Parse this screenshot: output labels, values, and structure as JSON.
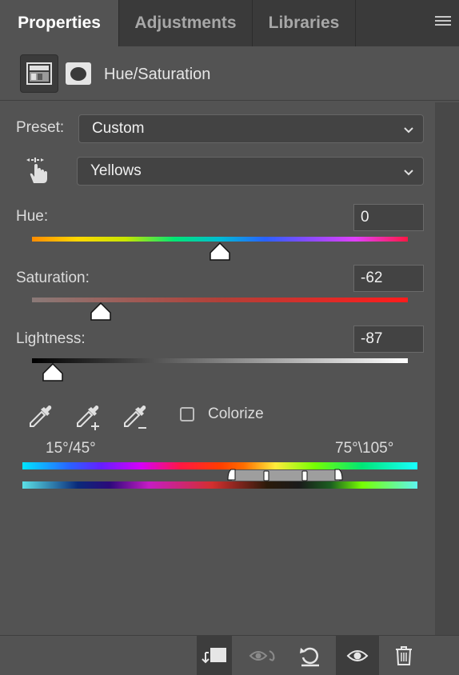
{
  "tabs": [
    {
      "label": "Properties",
      "active": true
    },
    {
      "label": "Adjustments",
      "active": false
    },
    {
      "label": "Libraries",
      "active": false
    }
  ],
  "header": {
    "title": "Hue/Saturation"
  },
  "preset": {
    "label": "Preset:",
    "value": "Custom"
  },
  "channel": {
    "value": "Yellows"
  },
  "hue": {
    "label": "Hue:",
    "value": "0"
  },
  "saturation": {
    "label": "Saturation:",
    "value": "-62"
  },
  "lightness": {
    "label": "Lightness:",
    "value": "-87"
  },
  "colorize": {
    "label": "Colorize",
    "checked": false
  },
  "range": {
    "left": "15°/45°",
    "right": "75°\\105°"
  },
  "colors": {
    "panel": "#535353",
    "tabbar": "#3a3a3a",
    "field": "#434343"
  }
}
